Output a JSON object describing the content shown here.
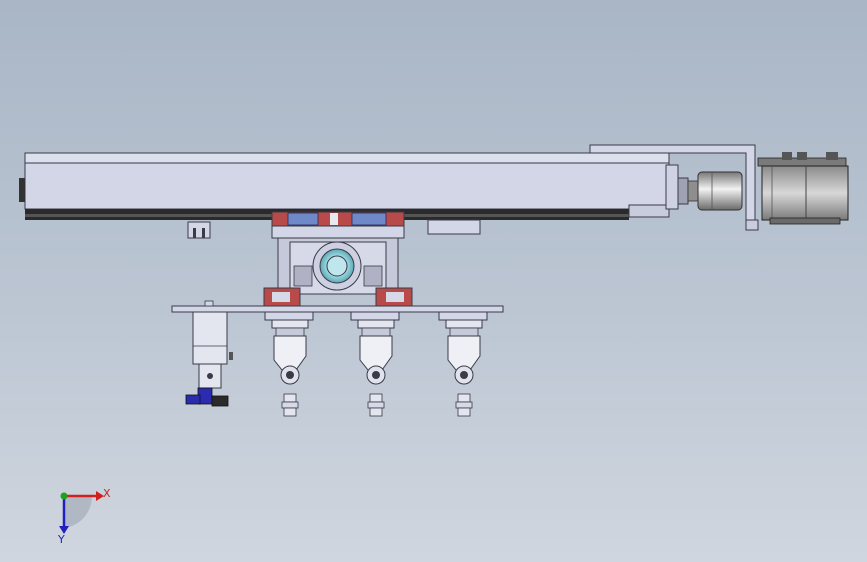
{
  "axes": {
    "x_label": "X",
    "y_label": "Y"
  },
  "colors": {
    "background_top": "#a9b6c6",
    "background_bottom": "#d0d6df",
    "body_fill": "#d3d6e6",
    "outline": "#3a3a48",
    "rail_dark": "#2a2a2a",
    "bearing_red": "#b84a4a",
    "bearing_blue": "#6f88c8",
    "fitting_blue": "#2b2bb0",
    "hub_cyan": "#8fd2dc",
    "axis_x": "#d02020",
    "axis_y": "#2020c0",
    "axis_z": "#20a020"
  },
  "parts": {
    "linear_module": "linear-actuator-body",
    "servo_motor": "servo-motor",
    "carriage": "slide-carriage",
    "suction_heads": 3,
    "cylinder": "air-cylinder"
  }
}
